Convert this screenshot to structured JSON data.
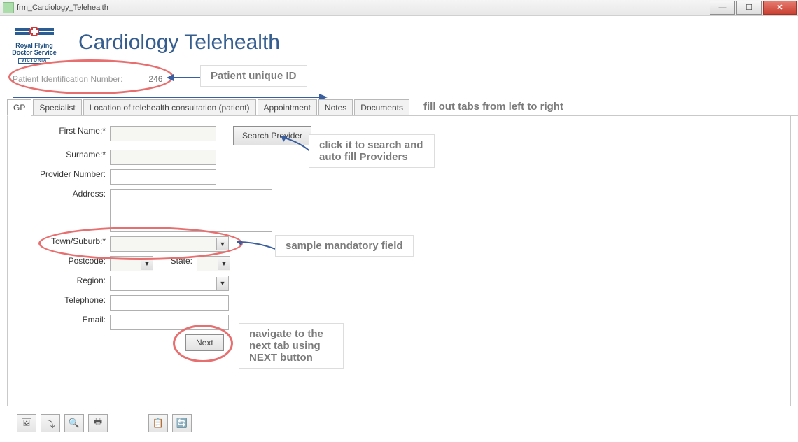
{
  "window": {
    "title": "frm_Cardiology_Telehealth"
  },
  "page": {
    "title": "Cardiology Telehealth"
  },
  "logo": {
    "line1": "Royal Flying",
    "line2": "Doctor Service",
    "badge": "VICTORIA"
  },
  "patientId": {
    "label": "Patient Identification Number:",
    "value": "246"
  },
  "tabs": [
    "GP",
    "Specialist",
    "Location of telehealth consultation (patient)",
    "Appointment",
    "Notes",
    "Documents"
  ],
  "form": {
    "firstName": "First Name:*",
    "surname": "Surname:*",
    "providerNumber": "Provider Number:",
    "address": "Address:",
    "townSuburb": "Town/Suburb:*",
    "postcode": "Postcode:",
    "state": "State:",
    "region": "Region:",
    "telephone": "Telephone:",
    "email": "Email:",
    "searchProvider": "Search Provider",
    "next": "Next"
  },
  "callouts": {
    "patientId": "Patient unique ID",
    "tabs": "fill out tabs from left to right",
    "search": "click it to search and auto fill Providers",
    "mandatory": "sample mandatory field",
    "next": "navigate to the next tab using NEXT button"
  }
}
